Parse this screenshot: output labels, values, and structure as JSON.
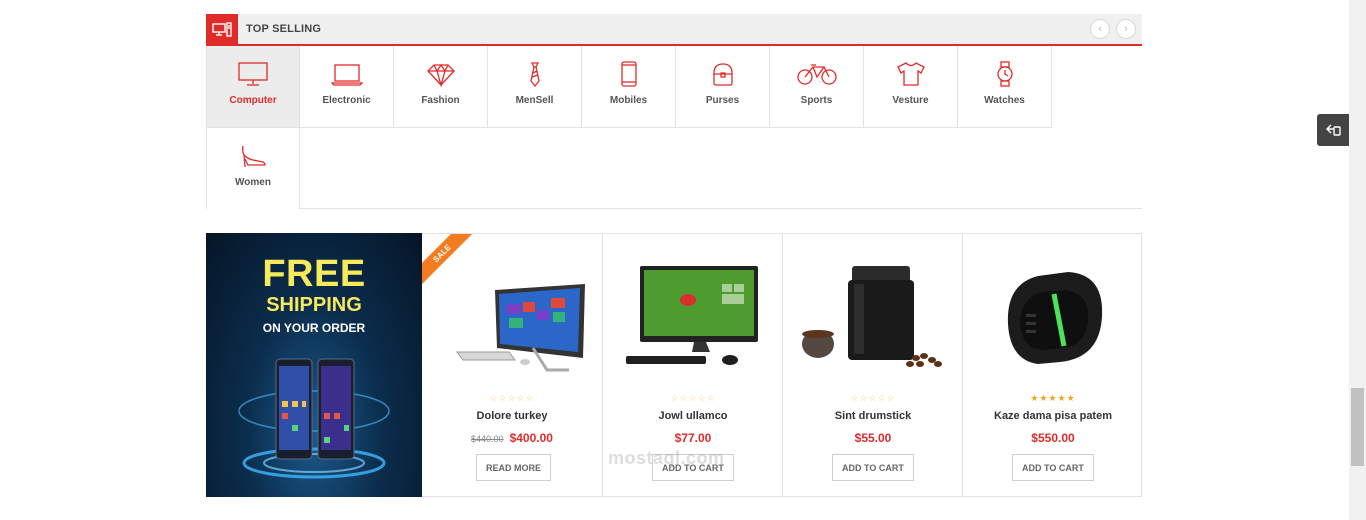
{
  "section": {
    "title": "TOP SELLING",
    "prev_label": "‹",
    "next_label": "›"
  },
  "categories": [
    {
      "label": "Computer",
      "icon": "monitor-icon",
      "active": true
    },
    {
      "label": "Electronic",
      "icon": "laptop-icon"
    },
    {
      "label": "Fashion",
      "icon": "diamond-icon"
    },
    {
      "label": "MenSell",
      "icon": "tie-icon"
    },
    {
      "label": "Mobiles",
      "icon": "phone-icon"
    },
    {
      "label": "Purses",
      "icon": "purse-icon"
    },
    {
      "label": "Sports",
      "icon": "bicycle-icon"
    },
    {
      "label": "Vesture",
      "icon": "tshirt-icon"
    },
    {
      "label": "Watches",
      "icon": "watch-icon"
    },
    {
      "label": "Women",
      "icon": "high-heel-icon"
    }
  ],
  "banner": {
    "line1": "FREE",
    "line2": "SHIPPING",
    "line3": "ON YOUR ORDER"
  },
  "products": [
    {
      "name": "Dolore turkey",
      "old_price": "$440.00",
      "price": "$400.00",
      "button": "READ MORE",
      "rating": 0,
      "sale": "SALE",
      "image": "all-in-one-pc-image"
    },
    {
      "name": "Jowl ullamco",
      "price": "$77.00",
      "button": "ADD TO CART",
      "rating": 0,
      "image": "desktop-monitor-image"
    },
    {
      "name": "Sint drumstick",
      "price": "$55.00",
      "button": "ADD TO CART",
      "rating": 0,
      "image": "coffee-grinder-image"
    },
    {
      "name": "Kaze dama pisa patem",
      "price": "$550.00",
      "button": "ADD TO CART",
      "rating": 5,
      "image": "fitness-band-image"
    }
  ],
  "watermark": "mostaql.com",
  "colors": {
    "accent": "#e02b2b",
    "star": "#f4a41f",
    "sale": "#f27c1f",
    "banner_text": "#f6ea5c"
  }
}
